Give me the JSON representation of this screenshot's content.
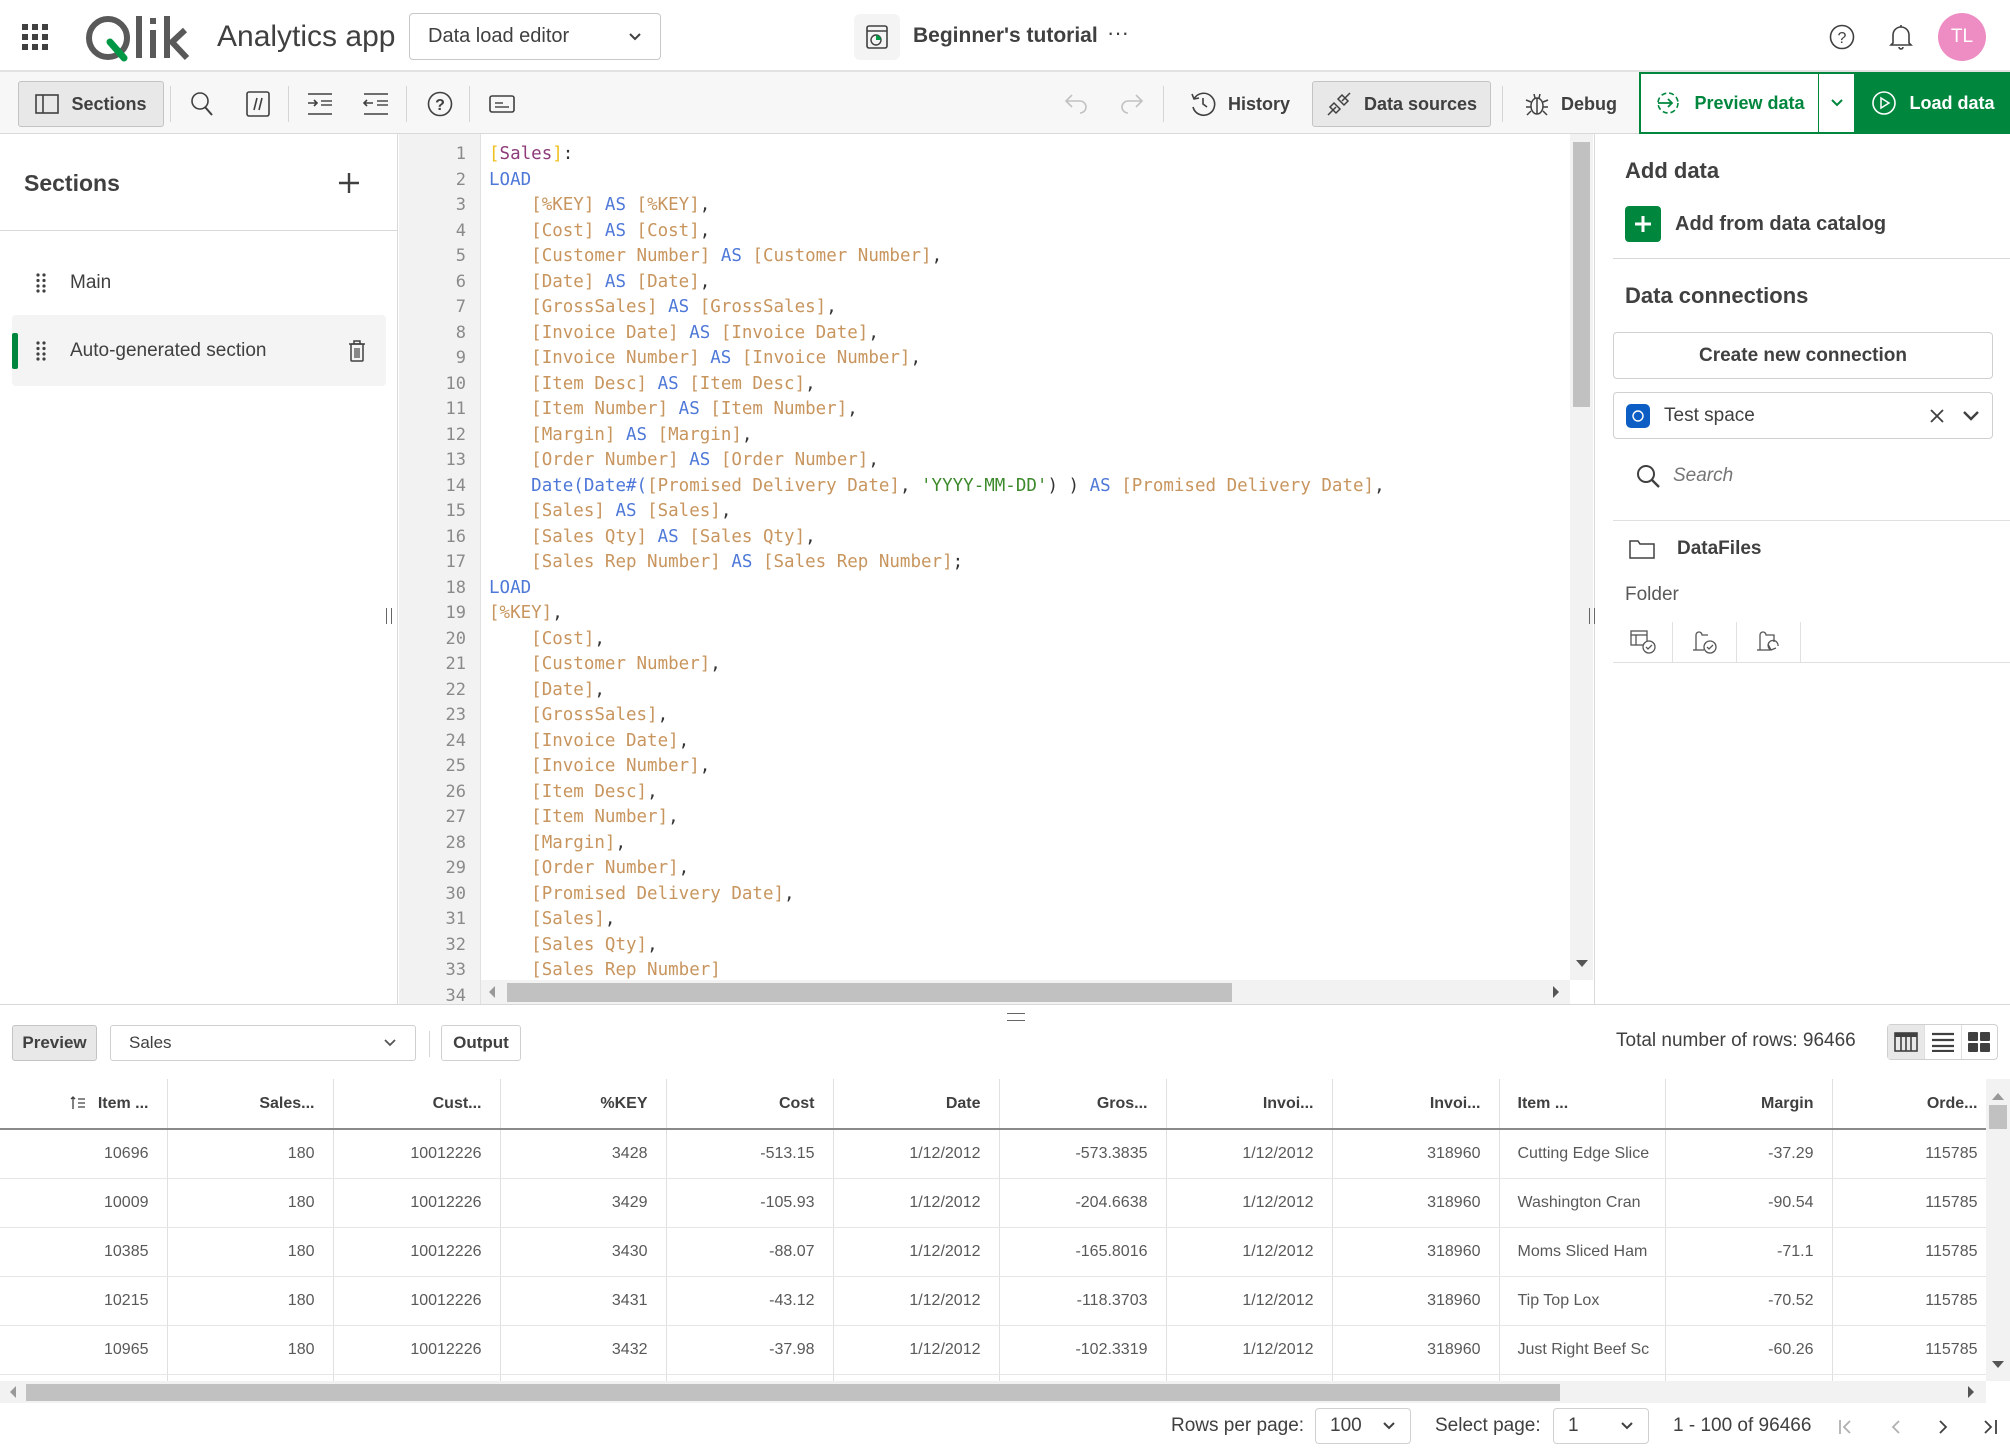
{
  "header": {
    "brand": "Qlik",
    "app_name": "Analytics app",
    "view_selector": "Data load editor",
    "sheet_title": "Beginner's tutorial",
    "more": "···",
    "avatar_initials": "TL",
    "avatar_color": "#ee8dc3"
  },
  "toolbar": {
    "sections_label": "Sections",
    "history_label": "History",
    "data_sources_label": "Data sources",
    "debug_label": "Debug",
    "preview_label": "Preview data",
    "load_label": "Load data",
    "accent": "#00873d"
  },
  "sections_panel": {
    "title": "Sections",
    "items": [
      {
        "label": "Main"
      },
      {
        "label": "Auto-generated section"
      }
    ]
  },
  "editor": {
    "lines": [
      "1",
      "2",
      "3",
      "4",
      "5",
      "6",
      "7",
      "8",
      "9",
      "10",
      "11",
      "12",
      "13",
      "14",
      "15",
      "16",
      "17",
      "18",
      "19",
      "20",
      "21",
      "22",
      "23",
      "24",
      "25",
      "26",
      "27",
      "28",
      "29",
      "30",
      "31",
      "32",
      "33",
      "34"
    ],
    "code": [
      [
        [
          "b",
          "["
        ],
        [
          "t",
          "Sales"
        ],
        [
          "b",
          "]"
        ],
        [
          "p",
          ":"
        ]
      ],
      [
        [
          "k",
          "LOAD"
        ]
      ],
      [
        [
          "p",
          "    "
        ],
        [
          "f",
          "[%KEY]"
        ],
        [
          "k",
          " AS "
        ],
        [
          "f",
          "[%KEY]"
        ],
        [
          "p",
          ","
        ]
      ],
      [
        [
          "p",
          "    "
        ],
        [
          "f",
          "[Cost]"
        ],
        [
          "k",
          " AS "
        ],
        [
          "f",
          "[Cost]"
        ],
        [
          "p",
          ","
        ]
      ],
      [
        [
          "p",
          "    "
        ],
        [
          "f",
          "[Customer Number]"
        ],
        [
          "k",
          " AS "
        ],
        [
          "f",
          "[Customer Number]"
        ],
        [
          "p",
          ","
        ]
      ],
      [
        [
          "p",
          "    "
        ],
        [
          "f",
          "[Date]"
        ],
        [
          "k",
          " AS "
        ],
        [
          "f",
          "[Date]"
        ],
        [
          "p",
          ","
        ]
      ],
      [
        [
          "p",
          "    "
        ],
        [
          "f",
          "[GrossSales]"
        ],
        [
          "k",
          " AS "
        ],
        [
          "f",
          "[GrossSales]"
        ],
        [
          "p",
          ","
        ]
      ],
      [
        [
          "p",
          "    "
        ],
        [
          "f",
          "[Invoice Date]"
        ],
        [
          "k",
          " AS "
        ],
        [
          "f",
          "[Invoice Date]"
        ],
        [
          "p",
          ","
        ]
      ],
      [
        [
          "p",
          "    "
        ],
        [
          "f",
          "[Invoice Number]"
        ],
        [
          "k",
          " AS "
        ],
        [
          "f",
          "[Invoice Number]"
        ],
        [
          "p",
          ","
        ]
      ],
      [
        [
          "p",
          "    "
        ],
        [
          "f",
          "[Item Desc]"
        ],
        [
          "k",
          " AS "
        ],
        [
          "f",
          "[Item Desc]"
        ],
        [
          "p",
          ","
        ]
      ],
      [
        [
          "p",
          "    "
        ],
        [
          "f",
          "[Item Number]"
        ],
        [
          "k",
          " AS "
        ],
        [
          "f",
          "[Item Number]"
        ],
        [
          "p",
          ","
        ]
      ],
      [
        [
          "p",
          "    "
        ],
        [
          "f",
          "[Margin]"
        ],
        [
          "k",
          " AS "
        ],
        [
          "f",
          "[Margin]"
        ],
        [
          "p",
          ","
        ]
      ],
      [
        [
          "p",
          "    "
        ],
        [
          "f",
          "[Order Number]"
        ],
        [
          "k",
          " AS "
        ],
        [
          "f",
          "[Order Number]"
        ],
        [
          "p",
          ","
        ]
      ],
      [
        [
          "p",
          "    "
        ],
        [
          "k",
          "Date(Date#("
        ],
        [
          "f",
          "[Promised Delivery Date]"
        ],
        [
          "p",
          ", "
        ],
        [
          "s",
          "'YYYY-MM-DD'"
        ],
        [
          "p",
          ") ) "
        ],
        [
          "k",
          "AS "
        ],
        [
          "f",
          "[Promised Delivery Date]"
        ],
        [
          "p",
          ","
        ]
      ],
      [
        [
          "p",
          "    "
        ],
        [
          "f",
          "[Sales]"
        ],
        [
          "k",
          " AS "
        ],
        [
          "f",
          "[Sales]"
        ],
        [
          "p",
          ","
        ]
      ],
      [
        [
          "p",
          "    "
        ],
        [
          "f",
          "[Sales Qty]"
        ],
        [
          "k",
          " AS "
        ],
        [
          "f",
          "[Sales Qty]"
        ],
        [
          "p",
          ","
        ]
      ],
      [
        [
          "p",
          "    "
        ],
        [
          "f",
          "[Sales Rep Number]"
        ],
        [
          "k",
          " AS "
        ],
        [
          "f",
          "[Sales Rep Number]"
        ],
        [
          "p",
          ";"
        ]
      ],
      [
        [
          "k",
          "LOAD"
        ]
      ],
      [
        [
          "f",
          "[%KEY]"
        ],
        [
          "p",
          ","
        ]
      ],
      [
        [
          "p",
          "    "
        ],
        [
          "f",
          "[Cost]"
        ],
        [
          "p",
          ","
        ]
      ],
      [
        [
          "p",
          "    "
        ],
        [
          "f",
          "[Customer Number]"
        ],
        [
          "p",
          ","
        ]
      ],
      [
        [
          "p",
          "    "
        ],
        [
          "f",
          "[Date]"
        ],
        [
          "p",
          ","
        ]
      ],
      [
        [
          "p",
          "    "
        ],
        [
          "f",
          "[GrossSales]"
        ],
        [
          "p",
          ","
        ]
      ],
      [
        [
          "p",
          "    "
        ],
        [
          "f",
          "[Invoice Date]"
        ],
        [
          "p",
          ","
        ]
      ],
      [
        [
          "p",
          "    "
        ],
        [
          "f",
          "[Invoice Number]"
        ],
        [
          "p",
          ","
        ]
      ],
      [
        [
          "p",
          "    "
        ],
        [
          "f",
          "[Item Desc]"
        ],
        [
          "p",
          ","
        ]
      ],
      [
        [
          "p",
          "    "
        ],
        [
          "f",
          "[Item Number]"
        ],
        [
          "p",
          ","
        ]
      ],
      [
        [
          "p",
          "    "
        ],
        [
          "f",
          "[Margin]"
        ],
        [
          "p",
          ","
        ]
      ],
      [
        [
          "p",
          "    "
        ],
        [
          "f",
          "[Order Number]"
        ],
        [
          "p",
          ","
        ]
      ],
      [
        [
          "p",
          "    "
        ],
        [
          "f",
          "[Promised Delivery Date]"
        ],
        [
          "p",
          ","
        ]
      ],
      [
        [
          "p",
          "    "
        ],
        [
          "f",
          "[Sales]"
        ],
        [
          "p",
          ","
        ]
      ],
      [
        [
          "p",
          "    "
        ],
        [
          "f",
          "[Sales Qty]"
        ],
        [
          "p",
          ","
        ]
      ],
      [
        [
          "p",
          "    "
        ],
        [
          "f",
          "[Sales Rep Number]"
        ]
      ]
    ]
  },
  "right_panel": {
    "add_data_title": "Add data",
    "add_catalog_label": "Add from data catalog",
    "connections_title": "Data connections",
    "create_connection_label": "Create new connection",
    "space_value": "Test space",
    "search_placeholder": "Search",
    "connection_name": "DataFiles",
    "connection_type": "Folder"
  },
  "preview_panel": {
    "preview_tab": "Preview",
    "table_select": "Sales",
    "output_tab": "Output",
    "total_rows": "Total number of rows: 96466",
    "columns": [
      "Item ...",
      "Sales...",
      "Cust...",
      "%KEY",
      "Cost",
      "Date",
      "Gros...",
      "Invoi...",
      "Invoi...",
      "Item ...",
      "Margin",
      "Orde..."
    ],
    "rows": [
      [
        "10696",
        "180",
        "10012226",
        "3428",
        "-513.15",
        "1/12/2012",
        "-573.3835",
        "1/12/2012",
        "318960",
        "Cutting Edge Slice",
        "-37.29",
        "115785"
      ],
      [
        "10009",
        "180",
        "10012226",
        "3429",
        "-105.93",
        "1/12/2012",
        "-204.6638",
        "1/12/2012",
        "318960",
        "Washington Cran",
        "-90.54",
        "115785"
      ],
      [
        "10385",
        "180",
        "10012226",
        "3430",
        "-88.07",
        "1/12/2012",
        "-165.8016",
        "1/12/2012",
        "318960",
        "Moms Sliced Ham",
        "-71.1",
        "115785"
      ],
      [
        "10215",
        "180",
        "10012226",
        "3431",
        "-43.12",
        "1/12/2012",
        "-118.3703",
        "1/12/2012",
        "318960",
        "Tip Top Lox",
        "-70.52",
        "115785"
      ],
      [
        "10965",
        "180",
        "10012226",
        "3432",
        "-37.98",
        "1/12/2012",
        "-102.3319",
        "1/12/2012",
        "318960",
        "Just Right Beef Sc",
        "-60.26",
        "115785"
      ]
    ],
    "rows_per_page_label": "Rows per page:",
    "rows_per_page_value": "100",
    "select_page_label": "Select page:",
    "select_page_value": "1",
    "range_text": "1 - 100 of 96466"
  }
}
